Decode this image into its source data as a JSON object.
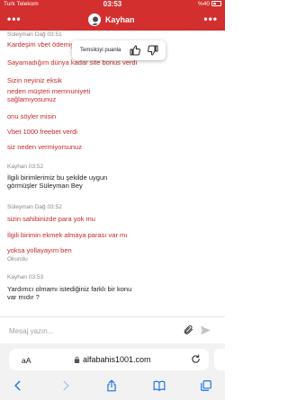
{
  "status_bar": {
    "carrier": "Turk Telekom",
    "time": "03:53",
    "battery": "%40"
  },
  "header": {
    "agent_name": "Kayhan"
  },
  "rating_popup": {
    "text": "Temsilciyi puanla"
  },
  "messages": [
    {
      "type": "label",
      "text": "Süleyman Dağ 03:51"
    },
    {
      "type": "user",
      "text": "Kardeşim vbet ödemiyor"
    },
    {
      "type": "user",
      "text": "Sayamadığım dünya kadar site bonus verdi"
    },
    {
      "type": "user",
      "text": "Sizin neyiniz eksik"
    },
    {
      "type": "user",
      "lines": [
        "neden müşteri memnuniyeti",
        "sağlamıyosunuz"
      ]
    },
    {
      "type": "user",
      "text": "onu söyler misin"
    },
    {
      "type": "user",
      "text": "Vbet 1000 freebet verdi"
    },
    {
      "type": "user",
      "text": "siz neden vermiyorsunuz"
    },
    {
      "type": "label",
      "text": "Kayhan 03:52"
    },
    {
      "type": "agent",
      "lines": [
        "İlgili birimlerimiz bu şekilde uygun",
        "görmüşler Süleyman Bey"
      ]
    },
    {
      "type": "label",
      "text": "Süleyman Dağ 03:52"
    },
    {
      "type": "user",
      "text": "sizin sahibinizde para yok mu"
    },
    {
      "type": "user",
      "text": "İlgili birimin ekmek almaya parası var mı"
    },
    {
      "type": "user",
      "text": "yoksa yollayayım ben"
    },
    {
      "type": "read",
      "text": "Okundu"
    },
    {
      "type": "label",
      "text": "Kayhan 03:53"
    },
    {
      "type": "agent",
      "lines": [
        "Yardımcı olmamı istediğiniz farklı bir konu",
        "var mıdır ?"
      ]
    }
  ],
  "input": {
    "placeholder": "Mesaj yazın..."
  },
  "browser": {
    "aa_label": "aA",
    "url": "alfabahis1001.com"
  },
  "colors": {
    "brand": "#d32f2f",
    "user_text": "#c62828"
  },
  "icons": [
    "menu-dots-icon",
    "avatar",
    "thumbs-up-icon",
    "thumbs-down-icon",
    "attach-icon",
    "send-icon",
    "lock-icon",
    "reload-icon",
    "back-icon",
    "forward-icon",
    "share-icon",
    "bookmarks-icon",
    "tabs-icon"
  ]
}
